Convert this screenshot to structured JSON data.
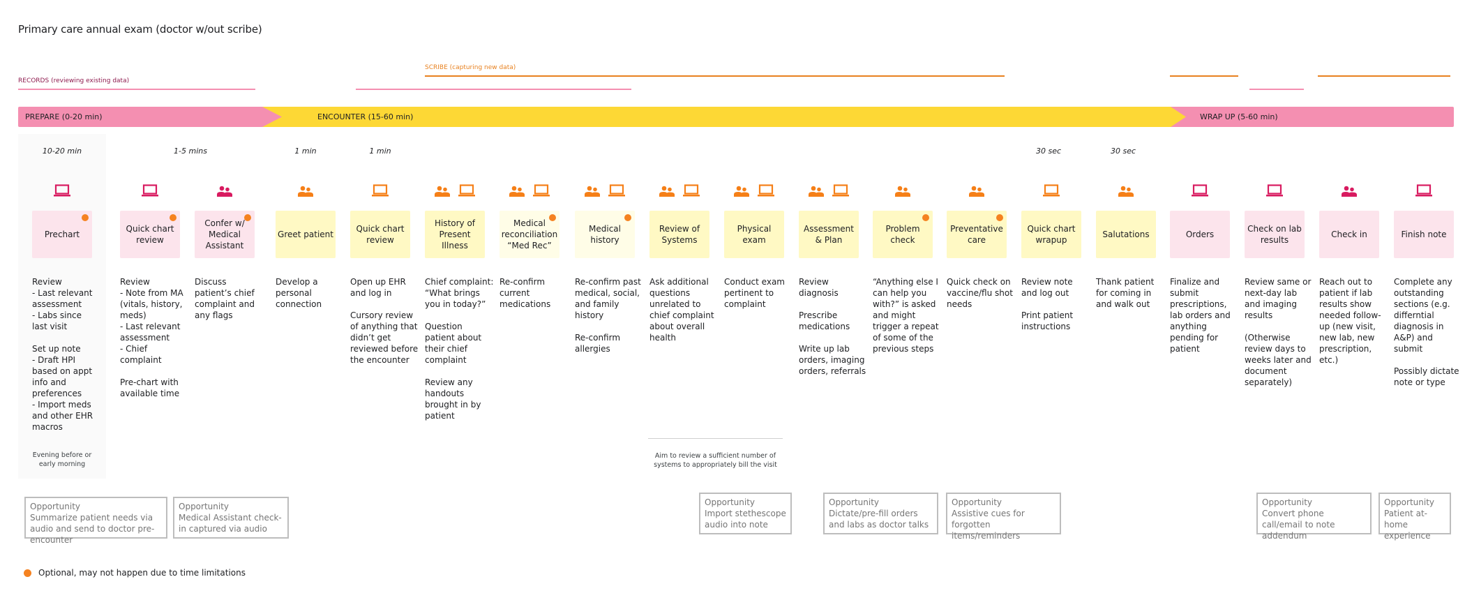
{
  "title": "Primary care annual exam (doctor w/out scribe)",
  "colors": {
    "records": "#f48fb1",
    "records_text": "#8e1a4e",
    "scribe": "#e8811f",
    "prepare_bar": "#f48fb1",
    "encounter_bar": "#fdd835",
    "wrapup_bar": "#f48fb1",
    "pink_icon": "#d81b60",
    "orange_icon": "#f57f17",
    "pink_card": "#fce4ec",
    "yellow_card": "#fff9c4",
    "light_yellow_card": "#fffde7",
    "optional_dot": "#f58220"
  },
  "lanes": {
    "records_label": "RECORDS (reviewing existing data)",
    "scribe_label": "SCRIBE (capturing new data)"
  },
  "phases": [
    {
      "label": "PREPARE (0-20 min)"
    },
    {
      "label": "ENCOUNTER (15-60 min)"
    },
    {
      "label": "WRAP UP (5-60 min)"
    }
  ],
  "durations": [
    {
      "label": "10-20 min"
    },
    {
      "label": "1-5 mins"
    },
    {
      "label": "1 min"
    },
    {
      "label": "1 min"
    },
    {
      "label": "30 sec"
    },
    {
      "label": "30 sec"
    }
  ],
  "steps": [
    {
      "label": "Prechart",
      "icons": [
        "laptop-icon"
      ],
      "icon_color": "pink",
      "card": "pink",
      "optional": true,
      "desc": "Review\n- Last relevant assessment\n- Labs since last visit\n\nSet up note\n- Draft HPI based on appt info and preferences\n- Import meds and other EHR macros"
    },
    {
      "label": "Quick chart review",
      "icons": [
        "laptop-icon"
      ],
      "icon_color": "pink",
      "card": "pink",
      "optional": true,
      "desc": "Review\n- Note from MA (vitals, history, meds)\n- Last relevant assessment\n- Chief complaint\n\nPre-chart with available time"
    },
    {
      "label": "Confer w/ Medical Assistant",
      "icons": [
        "people-icon"
      ],
      "icon_color": "pink",
      "card": "pink",
      "optional": true,
      "desc": "Discuss patient’s chief complaint and any flags"
    },
    {
      "label": "Greet patient",
      "icons": [
        "people-icon"
      ],
      "icon_color": "orange",
      "card": "yellow",
      "optional": false,
      "desc": "Develop  a personal connection"
    },
    {
      "label": "Quick chart review",
      "icons": [
        "laptop-icon"
      ],
      "icon_color": "orange",
      "card": "yellow",
      "optional": false,
      "desc": "Open up EHR and log in\n\nCursory review of anything that didn’t get reviewed before the encounter"
    },
    {
      "label": "History of Present Illness",
      "icons": [
        "people-icon",
        "laptop-icon"
      ],
      "icon_color": "orange",
      "card": "yellow",
      "optional": false,
      "desc": "Chief complaint: “What brings you in today?”\n\nQuestion patient about their chief complaint\n\nReview any handouts brought in by patient"
    },
    {
      "label": "Medical reconciliation “Med Rec”",
      "icons": [
        "people-icon",
        "laptop-icon"
      ],
      "icon_color": "orange",
      "card": "light-yellow",
      "optional": true,
      "desc": "Re-confirm current medications"
    },
    {
      "label": "Medical history",
      "icons": [
        "people-icon",
        "laptop-icon"
      ],
      "icon_color": "orange",
      "card": "light-yellow",
      "optional": true,
      "desc": "Re-confirm past medical, social, and family history\n\nRe-confirm allergies"
    },
    {
      "label": "Review of Systems",
      "icons": [
        "people-icon",
        "laptop-icon"
      ],
      "icon_color": "orange",
      "card": "yellow",
      "optional": false,
      "desc": "Ask additional questions unrelated to chief complaint about overall health"
    },
    {
      "label": "Physical exam",
      "icons": [
        "people-icon",
        "laptop-icon"
      ],
      "icon_color": "orange",
      "card": "yellow",
      "optional": false,
      "desc": "Conduct exam pertinent to complaint"
    },
    {
      "label": "Assessment & Plan",
      "icons": [
        "people-icon",
        "laptop-icon"
      ],
      "icon_color": "orange",
      "card": "yellow",
      "optional": false,
      "desc": "Review diagnosis\n\nPrescribe medications\n\nWrite up lab orders, imaging orders, referrals"
    },
    {
      "label": "Problem check",
      "icons": [
        "people-icon"
      ],
      "icon_color": "orange",
      "card": "yellow",
      "optional": true,
      "desc": "“Anything else I can help you with?” is asked and might trigger a repeat of some of the previous steps"
    },
    {
      "label": "Preventative care",
      "icons": [
        "people-icon"
      ],
      "icon_color": "orange",
      "card": "yellow",
      "optional": true,
      "desc": "Quick check on vaccine/flu shot needs"
    },
    {
      "label": "Quick chart wrapup",
      "icons": [
        "laptop-icon"
      ],
      "icon_color": "orange",
      "card": "yellow",
      "optional": false,
      "desc": "Review note and log out\n\nPrint patient instructions"
    },
    {
      "label": "Salutations",
      "icons": [
        "people-icon"
      ],
      "icon_color": "orange",
      "card": "yellow",
      "optional": false,
      "desc": "Thank patient for coming in and walk out"
    },
    {
      "label": "Orders",
      "icons": [
        "laptop-icon"
      ],
      "icon_color": "pink",
      "card": "pink",
      "optional": false,
      "desc": "Finalize and submit prescriptions, lab orders and anything pending for patient"
    },
    {
      "label": "Check on lab results",
      "icons": [
        "laptop-icon"
      ],
      "icon_color": "pink",
      "card": "pink",
      "optional": false,
      "desc": "Review same or next-day lab and imaging results\n\n(Otherwise review days to weeks later and document separately)"
    },
    {
      "label": "Check in",
      "icons": [
        "people-icon"
      ],
      "icon_color": "pink",
      "card": "pink",
      "optional": false,
      "desc": "Reach out to patient if lab results show needed follow-up (new visit, new lab, new prescription, etc.)"
    },
    {
      "label": "Finish note",
      "icons": [
        "laptop-icon"
      ],
      "icon_color": "pink",
      "card": "pink",
      "optional": false,
      "desc": "Complete any outstanding sections (e.g. differntial diagnosis in A&P) and submit\n\nPossibly dictate note or type"
    }
  ],
  "notes": {
    "prechart_timing": "Evening before or early morning",
    "ros_note": "Aim to review a sufficient number of systems to appropriately bill the visit"
  },
  "opportunities": [
    {
      "title": "Opportunity",
      "text": "Summarize patient needs via audio and send to doctor pre-encounter"
    },
    {
      "title": "Opportunity",
      "text": "Medical Assistant check-in captured via audio"
    },
    {
      "title": "Opportunity",
      "text": "Import stethescope audio into note"
    },
    {
      "title": "Opportunity",
      "text": "Dictate/pre-fill orders and labs as doctor talks"
    },
    {
      "title": "Opportunity",
      "text": "Assistive cues for forgotten items/reminders"
    },
    {
      "title": "Opportunity",
      "text": "Convert phone call/email to note addendum"
    },
    {
      "title": "Opportunity",
      "text": "Patient at-home experience"
    }
  ],
  "legend": {
    "optional_label": "Optional, may not happen due to time limitations"
  }
}
